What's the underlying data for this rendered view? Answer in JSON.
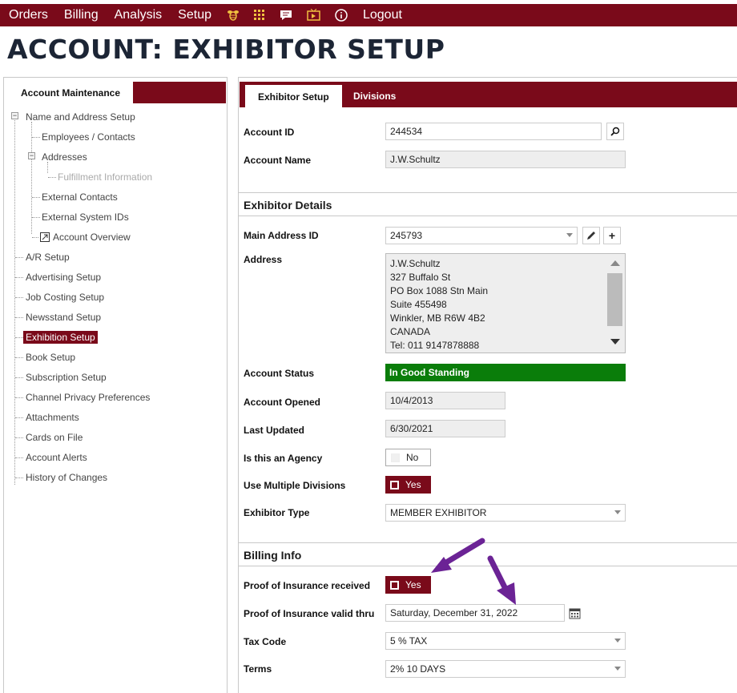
{
  "nav": {
    "items": [
      "Orders",
      "Billing",
      "Analysis",
      "Setup"
    ],
    "icons": [
      "bee-icon",
      "grid-icon",
      "chat-icon",
      "tv-icon",
      "info-icon"
    ],
    "logout": "Logout"
  },
  "page_title": "ACCOUNT: EXHIBITOR SETUP",
  "left": {
    "tab": "Account Maintenance",
    "tree": [
      "Name and Address Setup",
      "Employees / Contacts",
      "Addresses",
      "Fulfillment Information",
      "External Contacts",
      "External System IDs",
      "Account Overview",
      "A/R Setup",
      "Advertising Setup",
      "Job Costing Setup",
      "Newsstand Setup",
      "Exhibition Setup",
      "Book Setup",
      "Subscription Setup",
      "Channel Privacy Preferences",
      "Attachments",
      "Cards on File",
      "Account Alerts",
      "History of Changes"
    ]
  },
  "right": {
    "tabs": {
      "active": "Exhibitor Setup",
      "other": "Divisions"
    },
    "account_id_label": "Account ID",
    "account_id": "244534",
    "account_name_label": "Account Name",
    "account_name": "J.W.Schultz",
    "exhibitor_details_title": "Exhibitor Details",
    "main_address_label": "Main Address ID",
    "main_address_id": "245793",
    "address_label": "Address",
    "address_lines": [
      "J.W.Schultz",
      "327 Buffalo St",
      "PO Box 1088 Stn Main",
      "Suite 455498",
      "Winkler, MB R6W 4B2",
      "CANADA",
      "Tel: 011 9147878888"
    ],
    "account_status_label": "Account Status",
    "account_status": "In Good Standing",
    "account_opened_label": "Account Opened",
    "account_opened": "10/4/2013",
    "last_updated_label": "Last Updated",
    "last_updated": "6/30/2021",
    "agency_label": "Is this an Agency",
    "agency": "No",
    "multiple_divisions_label": "Use Multiple Divisions",
    "multiple_divisions": "Yes",
    "exhibitor_type_label": "Exhibitor Type",
    "exhibitor_type": "MEMBER EXHIBITOR",
    "billing_info_title": "Billing Info",
    "insurance_received_label": "Proof of Insurance received",
    "insurance_received": "Yes",
    "insurance_valid_label": "Proof of Insurance valid thru",
    "insurance_valid": "Saturday, December 31, 2022",
    "tax_code_label": "Tax Code",
    "tax_code": "5 % TAX",
    "terms_label": "Terms",
    "terms": "2% 10 DAYS"
  },
  "colors": {
    "brand": "#7a0a1a",
    "status_green": "#0a7d0a",
    "annotation_arrow": "#6b2395"
  }
}
